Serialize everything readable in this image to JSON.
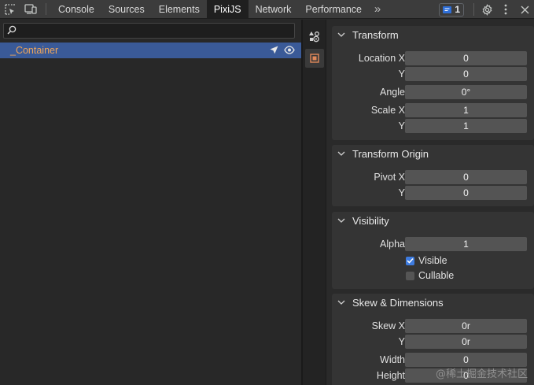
{
  "toolbar": {
    "tabs": [
      {
        "label": "Console"
      },
      {
        "label": "Sources"
      },
      {
        "label": "Elements"
      },
      {
        "label": "PixiJS"
      },
      {
        "label": "Network"
      },
      {
        "label": "Performance"
      }
    ],
    "active_tab": "PixiJS",
    "more_tabs_glyph": "»",
    "issues_count": "1",
    "icons": [
      "inspect-element-icon",
      "device-toolbar-icon",
      "more-tabs-icon",
      "issues-message-icon",
      "settings-gear-icon",
      "kebab-menu-icon",
      "close-icon"
    ]
  },
  "scene_tree": {
    "search_placeholder": "",
    "search_value": "",
    "items": [
      {
        "label": "_Container",
        "selected": true,
        "icons": [
          "select-cursor-icon",
          "visibility-eye-icon"
        ]
      }
    ]
  },
  "side_strip": {
    "icons": [
      "scene-graph-icon",
      "properties-panel-icon"
    ],
    "active": "properties-panel-icon"
  },
  "properties": {
    "transform": {
      "title": "Transform",
      "location_x_label": "Location X",
      "location_x": "0",
      "location_y_label": "Y",
      "location_y": "0",
      "angle_label": "Angle",
      "angle": "0°",
      "scale_x_label": "Scale X",
      "scale_x": "1",
      "scale_y_label": "Y",
      "scale_y": "1"
    },
    "transform_origin": {
      "title": "Transform Origin",
      "pivot_x_label": "Pivot X",
      "pivot_x": "0",
      "pivot_y_label": "Y",
      "pivot_y": "0"
    },
    "visibility": {
      "title": "Visibility",
      "alpha_label": "Alpha",
      "alpha": "1",
      "visible_label": "Visible",
      "visible_checked": true,
      "cullable_label": "Cullable",
      "cullable_checked": false
    },
    "skew_dimensions": {
      "title": "Skew & Dimensions",
      "skew_x_label": "Skew X",
      "skew_x": "0r",
      "skew_y_label": "Y",
      "skew_y": "0r",
      "width_label": "Width",
      "width": "0",
      "height_label": "Height",
      "height": "0"
    }
  },
  "watermark": "@稀土掘金技术社区",
  "colors": {
    "toolbar_bg": "#3c3c3c",
    "panel_bg": "#282828",
    "selected_row": "#3a5a98",
    "container_label": "#f0a65a",
    "field_bg": "#545454",
    "checkbox_on": "#3e7ce0"
  }
}
